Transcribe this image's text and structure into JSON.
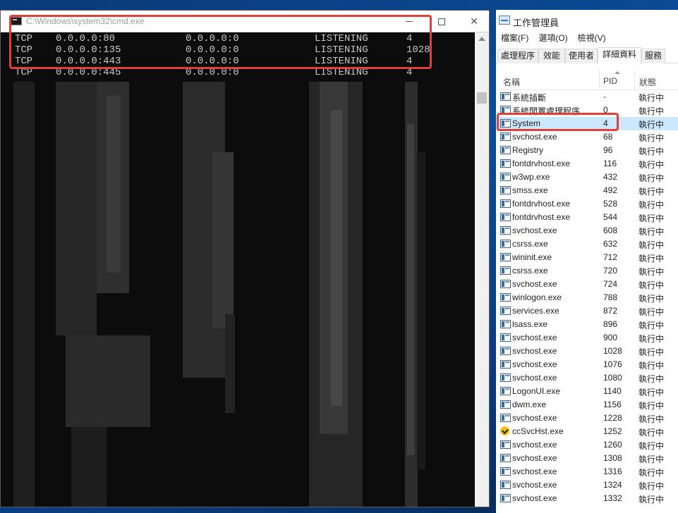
{
  "cmd": {
    "title": "C:\\Windows\\system32\\cmd.exe",
    "min_label": "—",
    "close_label": "✕",
    "lines": [
      {
        "proto": "TCP",
        "local": "0.0.0.0:80",
        "foreign": "0.0.0.0:0",
        "state": "LISTENING",
        "pid": "4"
      },
      {
        "proto": "TCP",
        "local": "0.0.0.0:135",
        "foreign": "0.0.0.0:0",
        "state": "LISTENING",
        "pid": "1028"
      },
      {
        "proto": "TCP",
        "local": "0.0.0.0:443",
        "foreign": "0.0.0.0:0",
        "state": "LISTENING",
        "pid": "4"
      },
      {
        "proto": "TCP",
        "local": "0.0.0.0:445",
        "foreign": "0.0.0.0:0",
        "state": "LISTENING",
        "pid": "4"
      }
    ],
    "highlight_color": "#e0403a"
  },
  "taskmgr": {
    "title": "工作管理員",
    "menu": [
      "檔案(F)",
      "選項(O)",
      "檢視(V)"
    ],
    "tabs": [
      "處理程序",
      "效能",
      "使用者",
      "詳細資料",
      "服務"
    ],
    "active_tab": "詳細資料",
    "columns": {
      "name": "名稱",
      "pid": "PID",
      "status": "狀態"
    },
    "rows": [
      {
        "name": "系統插斷",
        "pid": "-",
        "status": "執行中"
      },
      {
        "name": "系統閒置處理程序",
        "pid": "0",
        "status": "執行中"
      },
      {
        "name": "System",
        "pid": "4",
        "status": "執行中",
        "selected": true
      },
      {
        "name": "svchost.exe",
        "pid": "68",
        "status": "執行中"
      },
      {
        "name": "Registry",
        "pid": "96",
        "status": "執行中"
      },
      {
        "name": "fontdrvhost.exe",
        "pid": "116",
        "status": "執行中"
      },
      {
        "name": "w3wp.exe",
        "pid": "432",
        "status": "執行中"
      },
      {
        "name": "smss.exe",
        "pid": "492",
        "status": "執行中"
      },
      {
        "name": "fontdrvhost.exe",
        "pid": "528",
        "status": "執行中"
      },
      {
        "name": "fontdrvhost.exe",
        "pid": "544",
        "status": "執行中"
      },
      {
        "name": "svchost.exe",
        "pid": "608",
        "status": "執行中"
      },
      {
        "name": "csrss.exe",
        "pid": "632",
        "status": "執行中"
      },
      {
        "name": "wininit.exe",
        "pid": "712",
        "status": "執行中"
      },
      {
        "name": "csrss.exe",
        "pid": "720",
        "status": "執行中"
      },
      {
        "name": "svchost.exe",
        "pid": "724",
        "status": "執行中"
      },
      {
        "name": "winlogon.exe",
        "pid": "788",
        "status": "執行中"
      },
      {
        "name": "services.exe",
        "pid": "872",
        "status": "執行中"
      },
      {
        "name": "lsass.exe",
        "pid": "896",
        "status": "執行中"
      },
      {
        "name": "svchost.exe",
        "pid": "900",
        "status": "執行中"
      },
      {
        "name": "svchost.exe",
        "pid": "1028",
        "status": "執行中"
      },
      {
        "name": "svchost.exe",
        "pid": "1076",
        "status": "執行中"
      },
      {
        "name": "svchost.exe",
        "pid": "1080",
        "status": "執行中"
      },
      {
        "name": "LogonUI.exe",
        "pid": "1140",
        "status": "執行中"
      },
      {
        "name": "dwm.exe",
        "pid": "1156",
        "status": "執行中"
      },
      {
        "name": "svchost.exe",
        "pid": "1228",
        "status": "執行中"
      },
      {
        "name": "ccSvcHst.exe",
        "pid": "1252",
        "status": "執行中",
        "icon": "check-shield-icon"
      },
      {
        "name": "svchost.exe",
        "pid": "1260",
        "status": "執行中"
      },
      {
        "name": "svchost.exe",
        "pid": "1308",
        "status": "執行中"
      },
      {
        "name": "svchost.exe",
        "pid": "1316",
        "status": "執行中"
      },
      {
        "name": "svchost.exe",
        "pid": "1324",
        "status": "執行中"
      },
      {
        "name": "svchost.exe",
        "pid": "1332",
        "status": "執行中"
      }
    ]
  }
}
